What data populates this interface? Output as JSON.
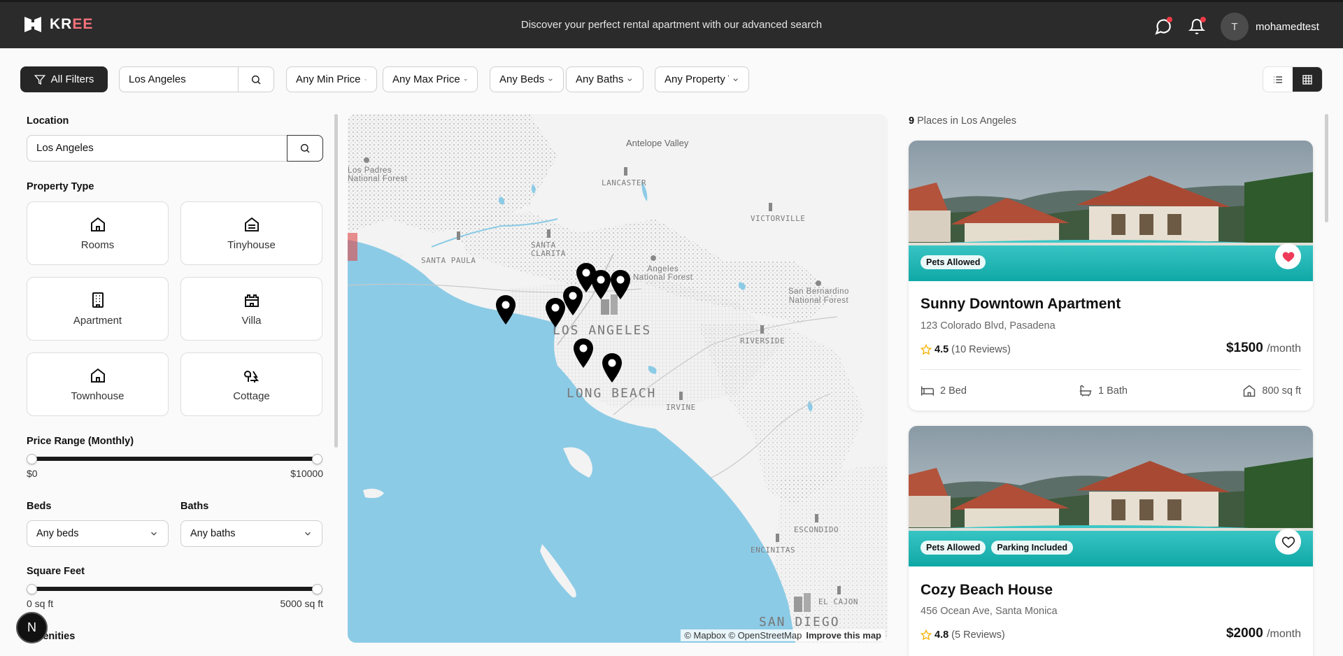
{
  "header": {
    "brand_kr": "KR",
    "brand_ee": "EE",
    "tagline": "Discover your perfect rental apartment with our advanced search",
    "avatar_initial": "T",
    "username": "mohamedtest"
  },
  "filters": {
    "all_filters": "All Filters",
    "search_value": "Los Angeles",
    "min_price": "Any Min Price",
    "max_price": "Any Max Price",
    "beds": "Any Beds",
    "baths": "Any Baths",
    "property": "Any Property Type"
  },
  "sidebar": {
    "location_title": "Location",
    "location_value": "Los Angeles",
    "property_type_title": "Property Type",
    "property_types": [
      "Rooms",
      "Tinyhouse",
      "Apartment",
      "Villa",
      "Townhouse",
      "Cottage"
    ],
    "price_title": "Price Range (Monthly)",
    "price_min": "$0",
    "price_max": "$10000",
    "beds_title": "Beds",
    "beds_value": "Any beds",
    "baths_title": "Baths",
    "baths_value": "Any baths",
    "sqft_title": "Square Feet",
    "sqft_min": "0 sq ft",
    "sqft_max": "5000 sq ft",
    "amenities_title": "Amenities",
    "n_badge": "N"
  },
  "map": {
    "labels": {
      "antelope": "Antelope Valley",
      "padres": "Los Padres\nNational Forest",
      "lancaster": "LANCASTER",
      "victorville": "VICTORVILLE",
      "santa_paula": "SANTA PAULA",
      "santa_clarita": "SANTA\nCLARITA",
      "angeles_forest": "Angeles\nNational Forest",
      "san_bernardino": "San Bernardino\nNational Forest",
      "los_angeles": "LOS ANGELES",
      "riverside": "RIVERSIDE",
      "long_beach": "LONG BEACH",
      "irvine": "IRVINE",
      "escondido": "ESCONDIDO",
      "encinitas": "ENCINITAS",
      "el_cajon": "EL CAJON",
      "san_diego": "SAN DIEGO"
    },
    "attribution": "© Mapbox © OpenStreetMap",
    "improve": "Improve this map"
  },
  "listings": {
    "count": "9",
    "count_suffix": "Places in Los Angeles",
    "items": [
      {
        "title": "Sunny Downtown Apartment",
        "address": "123 Colorado Blvd, Pasadena",
        "rating": "4.5",
        "reviews": "(10 Reviews)",
        "price": "$1500",
        "price_unit": "/month",
        "beds": "2 Bed",
        "baths": "1 Bath",
        "sqft": "800 sq ft",
        "badges": [
          "Pets Allowed"
        ],
        "favorited": true
      },
      {
        "title": "Cozy Beach House",
        "address": "456 Ocean Ave, Santa Monica",
        "rating": "4.8",
        "reviews": "(5 Reviews)",
        "price": "$2000",
        "price_unit": "/month",
        "badges": [
          "Pets Allowed",
          "Parking Included"
        ],
        "favorited": false
      }
    ]
  },
  "colors": {
    "header_bg": "#2b2b2b",
    "accent_red": "#ef3b46",
    "brand_ee": "#f3727b",
    "water": "#8ccbe6",
    "star": "#f5b301"
  }
}
